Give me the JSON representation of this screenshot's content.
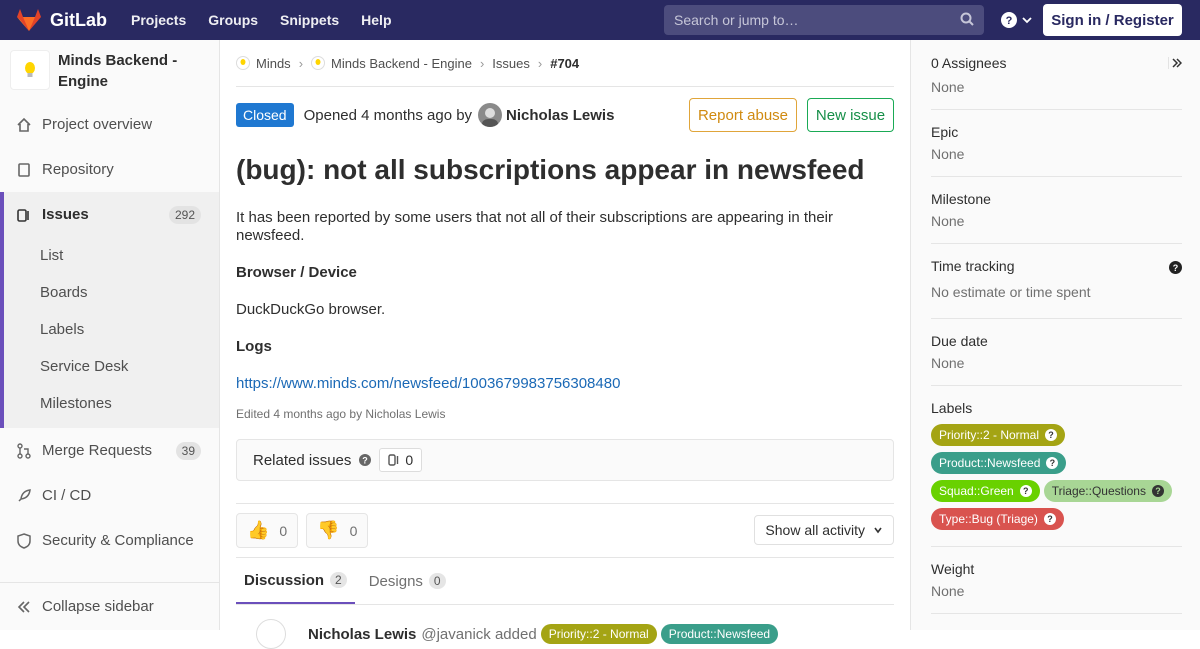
{
  "topnav": {
    "brand": "GitLab",
    "menu": [
      "Projects",
      "Groups",
      "Snippets",
      "Help"
    ],
    "search_placeholder": "Search or jump to…",
    "signin": "Sign in / Register"
  },
  "sidebar": {
    "project_name": "Minds Backend - Engine",
    "items": [
      {
        "label": "Project overview",
        "icon": "home-icon"
      },
      {
        "label": "Repository",
        "icon": "doc-icon"
      },
      {
        "label": "Issues",
        "icon": "issues-icon",
        "count": "292"
      },
      {
        "label": "Merge Requests",
        "icon": "merge-icon",
        "count": "39"
      },
      {
        "label": "CI / CD",
        "icon": "rocket-icon"
      },
      {
        "label": "Security & Compliance",
        "icon": "shield-icon"
      }
    ],
    "issue_subitems": [
      "List",
      "Boards",
      "Labels",
      "Service Desk",
      "Milestones"
    ],
    "collapse": "Collapse sidebar"
  },
  "breadcrumb": [
    "Minds",
    "Minds Backend - Engine",
    "Issues",
    "#704"
  ],
  "issue": {
    "status": "Closed",
    "opened_text": "Opened 4 months ago by",
    "author": "Nicholas Lewis",
    "report_abuse": "Report abuse",
    "new_issue": "New issue",
    "title": "(bug): not all subscriptions appear in newsfeed",
    "description": "It has been reported by some users that not all of their subscriptions are appearing in their newsfeed.",
    "h_browser": "Browser / Device",
    "browser": "DuckDuckGo browser.",
    "h_logs": "Logs",
    "log_link": "https://www.minds.com/newsfeed/1003679983756308480",
    "edited": "Edited 4 months ago by Nicholas Lewis",
    "related_label": "Related issues",
    "related_count": "0",
    "thumbs_up": "0",
    "thumbs_down": "0",
    "show_activity": "Show all activity"
  },
  "tabs": [
    {
      "label": "Discussion",
      "count": "2"
    },
    {
      "label": "Designs",
      "count": "0"
    }
  ],
  "note": {
    "author": "Nicholas Lewis",
    "handle": "@javanick added",
    "labels": [
      "Priority::2 - Normal",
      "Product::Newsfeed"
    ]
  },
  "right": {
    "assignees_title": "0 Assignees",
    "assignees_value": "None",
    "epic_title": "Epic",
    "epic_value": "None",
    "milestone_title": "Milestone",
    "milestone_value": "None",
    "time_title": "Time tracking",
    "time_value": "No estimate or time spent",
    "due_title": "Due date",
    "due_value": "None",
    "labels_title": "Labels",
    "labels": [
      {
        "text": "Priority::2 - Normal",
        "color": "#a4a414"
      },
      {
        "text": "Product::Newsfeed",
        "color": "#3a9e8a"
      },
      {
        "text": "Squad::Green",
        "color": "#69d100"
      },
      {
        "text": "Triage::Questions",
        "color": "#a8d695"
      },
      {
        "text": "Type::Bug (Triage)",
        "color": "#d9534f"
      }
    ],
    "weight_title": "Weight",
    "weight_value": "None"
  }
}
